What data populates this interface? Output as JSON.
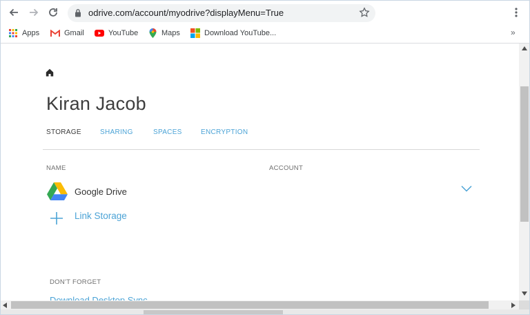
{
  "browser": {
    "url": "odrive.com/account/myodrive?displayMenu=True",
    "bookmarks": [
      {
        "label": "Apps",
        "icon": "apps-grid-icon"
      },
      {
        "label": "Gmail",
        "icon": "gmail-icon"
      },
      {
        "label": "YouTube",
        "icon": "youtube-icon"
      },
      {
        "label": "Maps",
        "icon": "maps-pin-icon"
      },
      {
        "label": "Download YouTube...",
        "icon": "ms-tiles-icon"
      }
    ],
    "more_label": "»"
  },
  "page": {
    "user_name": "Kiran Jacob",
    "tabs": [
      {
        "label": "STORAGE",
        "active": true
      },
      {
        "label": "SHARING",
        "active": false
      },
      {
        "label": "SPACES",
        "active": false
      },
      {
        "label": "ENCRYPTION",
        "active": false
      }
    ],
    "columns": {
      "name": "NAME",
      "account": "ACCOUNT"
    },
    "storage_items": [
      {
        "name": "Google Drive",
        "icon": "google-drive-icon"
      }
    ],
    "link_storage_label": "Link Storage",
    "dont_forget_label": "DON'T FORGET",
    "download_link_label": "Download Desktop Sync"
  },
  "colors": {
    "accent": "#4ba3d6",
    "title_text": "#3d3d3d"
  }
}
